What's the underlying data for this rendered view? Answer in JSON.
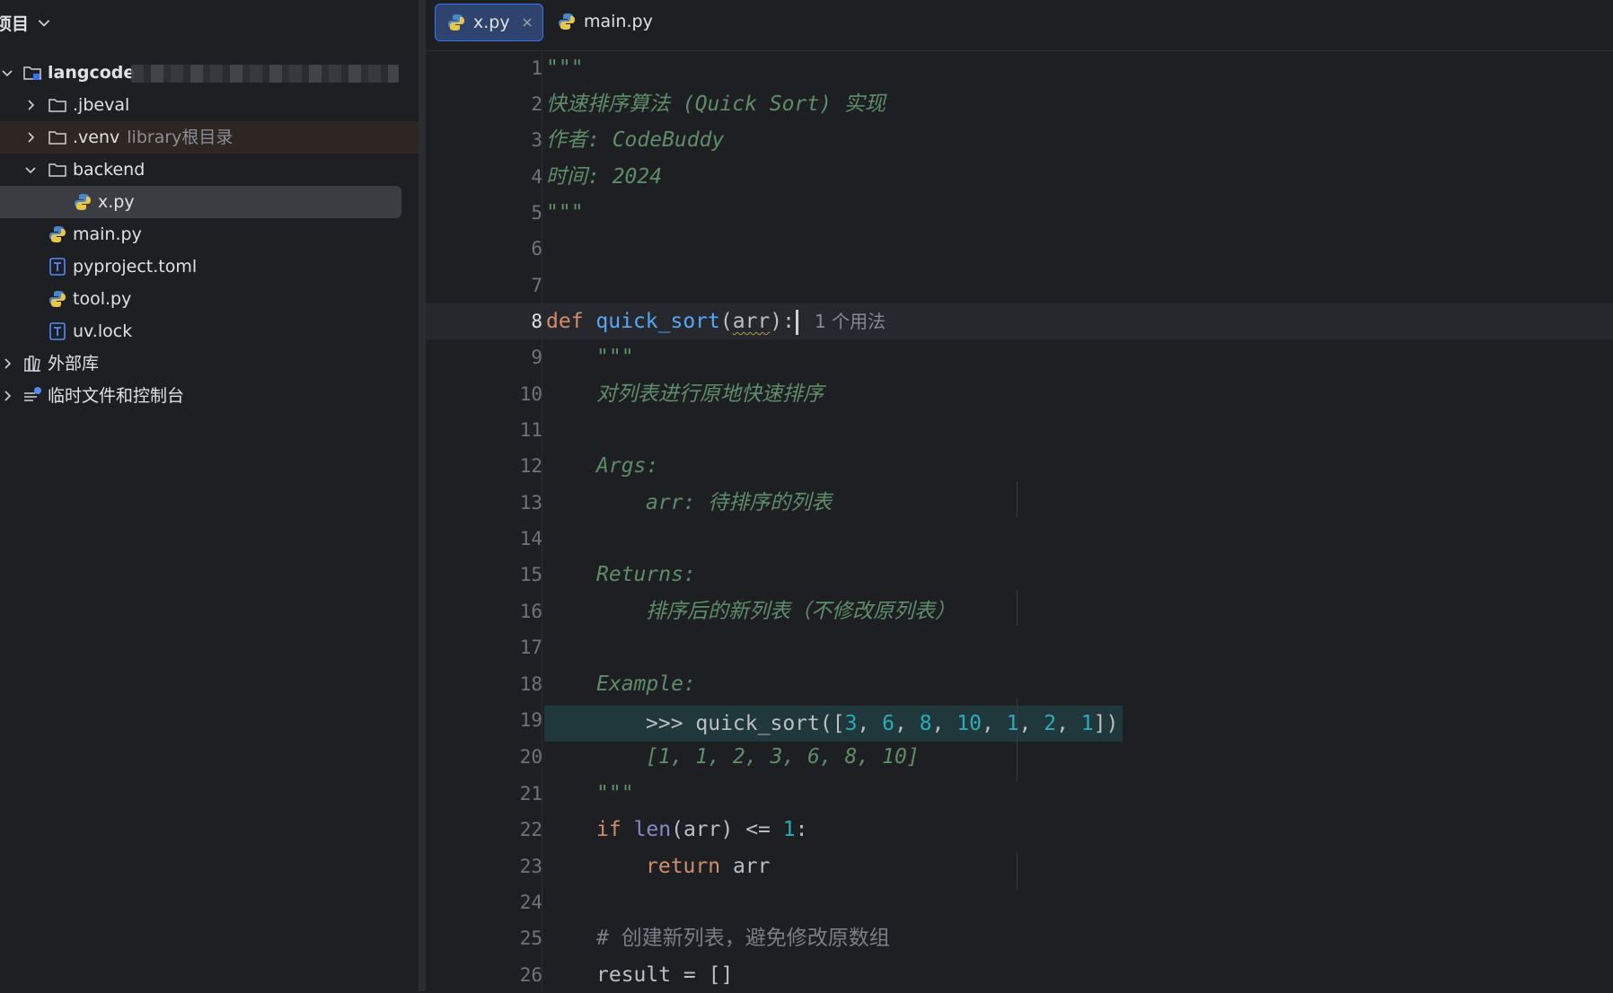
{
  "sidebar": {
    "header": "项目",
    "items": [
      {
        "label": "langcode",
        "type": "root"
      },
      {
        "label": ".jbeval",
        "type": "folder"
      },
      {
        "label": ".venv",
        "suffix": "library根目录",
        "type": "folder"
      },
      {
        "label": "backend",
        "type": "folder"
      },
      {
        "label": "x.py",
        "type": "python"
      },
      {
        "label": "main.py",
        "type": "python"
      },
      {
        "label": "pyproject.toml",
        "type": "toml"
      },
      {
        "label": "tool.py",
        "type": "python"
      },
      {
        "label": "uv.lock",
        "type": "toml"
      },
      {
        "label": "外部库",
        "type": "library"
      },
      {
        "label": "临时文件和控制台",
        "type": "scratch"
      }
    ]
  },
  "tabs": [
    {
      "label": "x.py",
      "active": true
    },
    {
      "label": "main.py",
      "active": false
    }
  ],
  "editor": {
    "line_numbers": [
      "1",
      "2",
      "3",
      "4",
      "5",
      "6",
      "7",
      "8",
      "9",
      "10",
      "11",
      "12",
      "13",
      "14",
      "15",
      "16",
      "17",
      "18",
      "19",
      "20",
      "21",
      "22",
      "23",
      "24",
      "25",
      "26"
    ],
    "current_line": 8,
    "usage_hint": "1 个用法",
    "lines": {
      "l1": "\"\"\"",
      "l2": "快速排序算法 (Quick Sort) 实现",
      "l3": "作者: CodeBuddy",
      "l4": "时间: 2024",
      "l5": "\"\"\"",
      "l8_kw": "def",
      "l8_fn": "quick_sort",
      "l8_open": "(",
      "l8_param": "arr",
      "l8_close": "):",
      "l9": "\"\"\"",
      "l10": "对列表进行原地快速排序",
      "l12": "Args:",
      "l13": "arr: 待排序的列表",
      "l15": "Returns:",
      "l16": "排序后的新列表（不修改原列表）",
      "l18": "Example:",
      "l19": {
        "prompt": ">>> quick_sort([",
        "n1": "3",
        "n2": "6",
        "n3": "8",
        "n4": "10",
        "n5": "1",
        "n6": "2",
        "n7": "1",
        "sep": ", ",
        "end": "])"
      },
      "l20": "[1, 1, 2, 3, 6, 8, 10]",
      "l21": "\"\"\"",
      "l22": {
        "kw": "if",
        "builtin": "len",
        "rest": "(arr) <= ",
        "num": "1",
        "end": ":"
      },
      "l23": {
        "kw": "return",
        "rest": " arr"
      },
      "l25": "# 创建新列表，避免修改原数组",
      "l26": "result = []"
    }
  },
  "colors": {
    "background": "#1e1f22",
    "active_tab": "#2e436e",
    "tab_border": "#3574f0",
    "docstring": "#5f8c6a",
    "keyword": "#cf8e6d",
    "function": "#56a8f5",
    "number": "#2aacb8"
  },
  "icons": [
    "chevron-down-icon",
    "chevron-right-icon",
    "folder-icon",
    "module-folder-icon",
    "python-file-icon",
    "toml-file-icon",
    "library-icon",
    "scratch-icon",
    "close-icon"
  ]
}
